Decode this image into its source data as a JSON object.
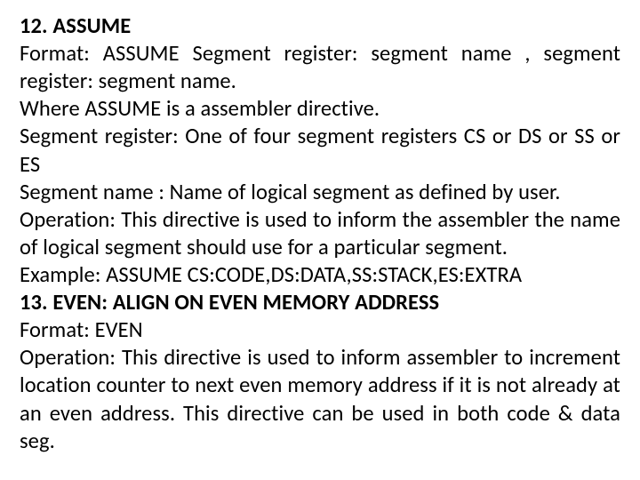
{
  "sections": [
    {
      "heading": "12. ASSUME",
      "lines": [
        "Format: ASSUME Segment register: segment name , segment register: segment name.",
        "Where ASSUME is a assembler directive.",
        "Segment register: One of four segment registers CS or DS or SS or ES",
        "Segment name : Name of logical segment as defined by user.",
        "Operation: This directive is used to inform the assembler the name of logical segment should use for a particular segment.",
        "Example: ASSUME CS:CODE,DS:DATA,SS:STACK,ES:EXTRA"
      ]
    },
    {
      "heading": "13. EVEN: ALIGN ON EVEN MEMORY ADDRESS",
      "lines": [
        "Format: EVEN",
        "Operation: This directive is used to inform assembler to increment location counter to next even memory address if it is not already at an even address. This directive can be used in both code & data seg."
      ]
    }
  ]
}
